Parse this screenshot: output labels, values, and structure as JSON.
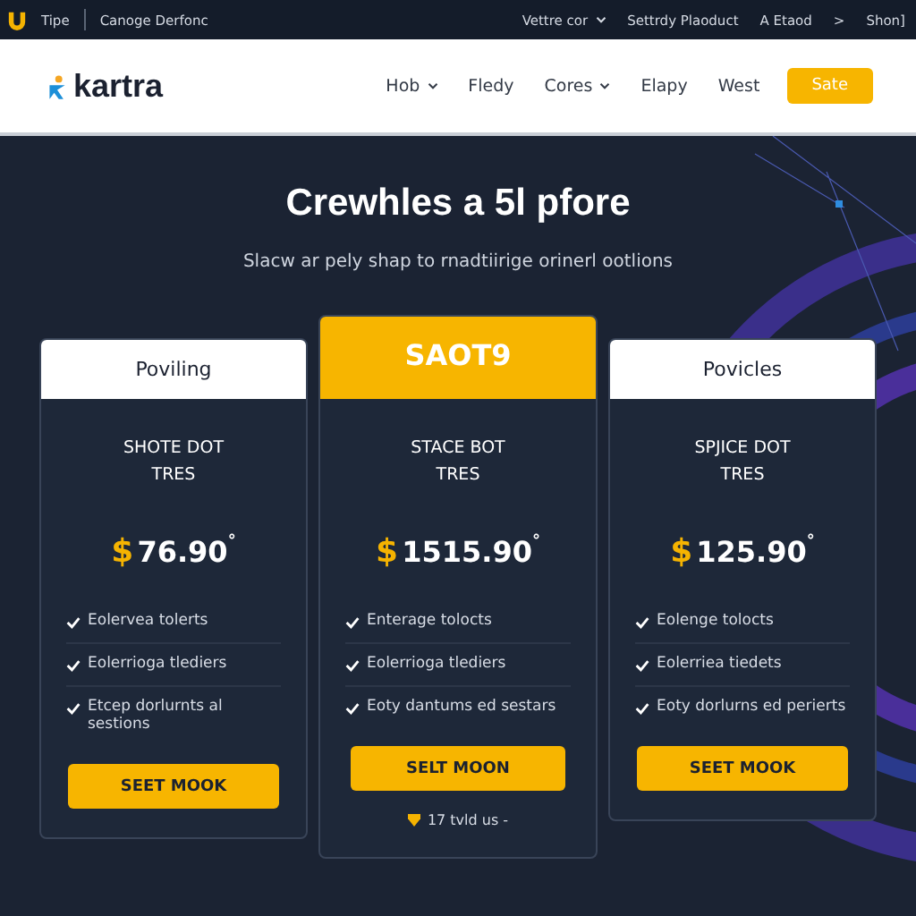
{
  "top_bar": {
    "brand": "Tipe",
    "tagline": "Canoge Derfonc",
    "links": [
      {
        "label": "Vettre cor",
        "dropdown": true
      },
      {
        "label": "Settrdy Plaoduct",
        "dropdown": false
      },
      {
        "label": "A Etaod",
        "dropdown": false
      },
      {
        "label": ">",
        "dropdown": false
      },
      {
        "label": "Shon]",
        "dropdown": false
      }
    ]
  },
  "nav": {
    "logo": "kartra",
    "items": [
      {
        "label": "Hob",
        "dropdown": true
      },
      {
        "label": "Fledy",
        "dropdown": false
      },
      {
        "label": "Cores",
        "dropdown": true
      },
      {
        "label": "Elapy",
        "dropdown": false
      },
      {
        "label": "West",
        "dropdown": false
      }
    ],
    "button": "Sate"
  },
  "hero": {
    "title": "Crewhles a 5l pfore",
    "subtitle": "Slacw ar pely shap to rnadtiirige orinerl ootlions"
  },
  "plans": [
    {
      "header": "Poviling",
      "featured": false,
      "name_lines": [
        "SHOTE DOT",
        "TRES"
      ],
      "currency": "$",
      "amount": "76.90",
      "mark": "°",
      "features": [
        "Eolerveа tolerts",
        "Eolerrioga tlediers",
        "Etcep dorlurnts al sestions"
      ],
      "button": "SEET MOOK"
    },
    {
      "header": "SAOT9",
      "featured": true,
      "name_lines": [
        "STACE BOT",
        "TRES"
      ],
      "currency": "$",
      "amount": "1515.90",
      "mark": "°",
      "features": [
        "Enterage tolocts",
        "Eolerrioga tlediers",
        "Eoty dantums ed sestars"
      ],
      "button": "SELT MOON",
      "note": "17 tvld us -"
    },
    {
      "header": "Povicles",
      "featured": false,
      "name_lines": [
        "SPJICE DOT",
        "TRES"
      ],
      "currency": "$",
      "amount": "125.90",
      "mark": "°",
      "features": [
        "Eolenge tolocts",
        "Eolerriea tiedets",
        "Eoty dorlurns ed perierts"
      ],
      "button": "SEET MOOK"
    }
  ]
}
